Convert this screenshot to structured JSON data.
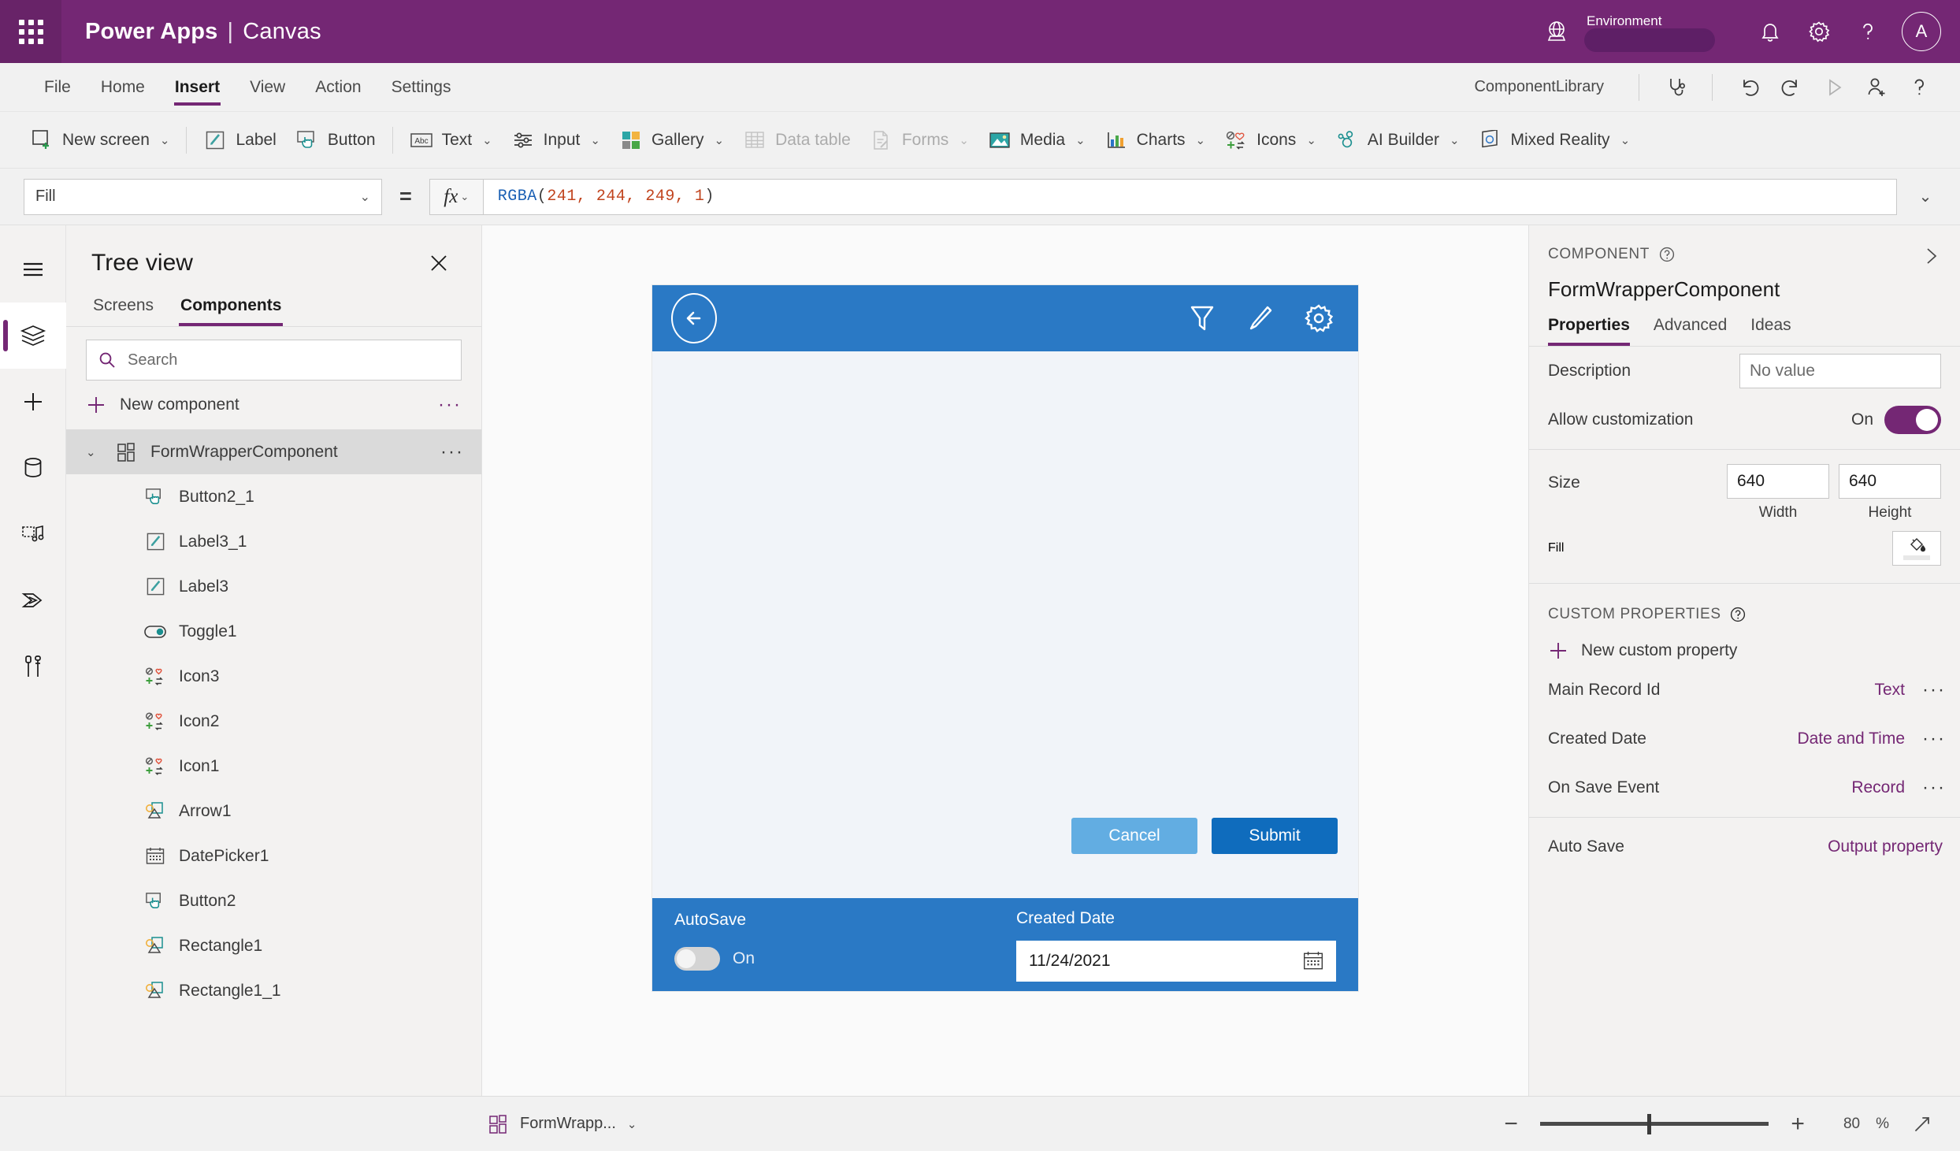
{
  "topbar": {
    "waffle": "app-launcher",
    "brand": "Power Apps",
    "separator": "|",
    "product": "Canvas",
    "environment_label": "Environment",
    "environment_value": "",
    "icons": [
      "globe-icon",
      "bell-icon",
      "gear-icon",
      "help-icon"
    ],
    "avatar_initial": "A"
  },
  "menubar": {
    "items": [
      {
        "label": "File",
        "active": false
      },
      {
        "label": "Home",
        "active": false
      },
      {
        "label": "Insert",
        "active": true
      },
      {
        "label": "View",
        "active": false
      },
      {
        "label": "Action",
        "active": false
      },
      {
        "label": "Settings",
        "active": false
      }
    ],
    "app_name": "ComponentLibrary",
    "right_icons": [
      "stethoscope-icon",
      "undo-icon",
      "redo-icon",
      "play-icon",
      "share-icon",
      "help-icon"
    ]
  },
  "ribbon": {
    "items": [
      {
        "label": "New screen",
        "icon": "new-screen-icon",
        "caret": true,
        "disabled": false
      },
      {
        "label": "Label",
        "icon": "label-icon",
        "caret": false,
        "disabled": false
      },
      {
        "label": "Button",
        "icon": "button-icon",
        "caret": false,
        "disabled": false
      },
      {
        "label": "Text",
        "icon": "text-icon",
        "caret": true,
        "disabled": false
      },
      {
        "label": "Input",
        "icon": "input-icon",
        "caret": true,
        "disabled": false
      },
      {
        "label": "Gallery",
        "icon": "gallery-icon",
        "caret": true,
        "disabled": false
      },
      {
        "label": "Data table",
        "icon": "data-table-icon",
        "caret": false,
        "disabled": true
      },
      {
        "label": "Forms",
        "icon": "forms-icon",
        "caret": true,
        "disabled": true
      },
      {
        "label": "Media",
        "icon": "media-icon",
        "caret": true,
        "disabled": false
      },
      {
        "label": "Charts",
        "icon": "charts-icon",
        "caret": true,
        "disabled": false
      },
      {
        "label": "Icons",
        "icon": "icons-icon",
        "caret": true,
        "disabled": false
      },
      {
        "label": "AI Builder",
        "icon": "ai-builder-icon",
        "caret": true,
        "disabled": false
      },
      {
        "label": "Mixed Reality",
        "icon": "mixed-reality-icon",
        "caret": true,
        "disabled": false
      }
    ]
  },
  "formula_bar": {
    "property": "Fill",
    "equals": "=",
    "fx": "fx",
    "formula_fn": "RGBA",
    "formula_open": "(",
    "formula_args": "241, 244, 249, 1",
    "formula_close": ")"
  },
  "rail": {
    "items": [
      {
        "name": "hamburger-icon",
        "selected": false
      },
      {
        "name": "tree-view-icon",
        "selected": true
      },
      {
        "name": "insert-icon",
        "selected": false
      },
      {
        "name": "data-icon",
        "selected": false
      },
      {
        "name": "media-icon",
        "selected": false
      },
      {
        "name": "power-automate-icon",
        "selected": false
      },
      {
        "name": "variables-icon",
        "selected": false
      }
    ]
  },
  "tree": {
    "title": "Tree view",
    "close": "×",
    "tabs": [
      {
        "label": "Screens",
        "active": false
      },
      {
        "label": "Components",
        "active": true
      }
    ],
    "search_placeholder": "Search",
    "new_component": "New component",
    "root": {
      "label": "FormWrapperComponent",
      "icon": "component-icon",
      "selected": true,
      "expanded": true
    },
    "children": [
      {
        "label": "Button2_1",
        "icon": "button-icon"
      },
      {
        "label": "Label3_1",
        "icon": "label-icon"
      },
      {
        "label": "Label3",
        "icon": "label-icon"
      },
      {
        "label": "Toggle1",
        "icon": "toggle-icon"
      },
      {
        "label": "Icon3",
        "icon": "icons-icon"
      },
      {
        "label": "Icon2",
        "icon": "icons-icon"
      },
      {
        "label": "Icon1",
        "icon": "icons-icon"
      },
      {
        "label": "Arrow1",
        "icon": "shape-icon"
      },
      {
        "label": "DatePicker1",
        "icon": "datepicker-icon"
      },
      {
        "label": "Button2",
        "icon": "button-icon"
      },
      {
        "label": "Rectangle1",
        "icon": "shape-icon"
      },
      {
        "label": "Rectangle1_1",
        "icon": "shape-icon"
      }
    ]
  },
  "canvas": {
    "header_icons": [
      "back-arrow-icon",
      "filter-icon",
      "pencil-icon",
      "gear-icon"
    ],
    "cancel_label": "Cancel",
    "submit_label": "Submit",
    "autosave_label": "AutoSave",
    "autosave_state": "On",
    "created_date_label": "Created Date",
    "created_date_value": "11/24/2021",
    "calendar_icon": "calendar-icon",
    "colors": {
      "header": "#2a79c5",
      "body": "#f1f4f9",
      "submit": "#0f6cbd",
      "cancel": "#62ade2"
    }
  },
  "properties": {
    "kicker": "COMPONENT",
    "help_icon": "help-circle-icon",
    "expand_icon": "chevron-right-icon",
    "component_name": "FormWrapperComponent",
    "tabs": [
      {
        "label": "Properties",
        "active": true
      },
      {
        "label": "Advanced",
        "active": false
      },
      {
        "label": "Ideas",
        "active": false
      }
    ],
    "description_label": "Description",
    "description_value": "No value",
    "allow_customization_label": "Allow customization",
    "allow_customization_state": "On",
    "size_label": "Size",
    "width_value": "640",
    "width_caption": "Width",
    "height_value": "640",
    "height_caption": "Height",
    "fill_label": "Fill",
    "fill_icon": "paint-bucket-icon",
    "custom_properties_kicker": "CUSTOM PROPERTIES",
    "new_custom_property": "New custom property",
    "custom_properties": [
      {
        "name": "Main Record Id",
        "type": "Text",
        "has_menu": true
      },
      {
        "name": "Created Date",
        "type": "Date and Time",
        "has_menu": true
      },
      {
        "name": "On Save Event",
        "type": "Record",
        "has_menu": true
      },
      {
        "name": "Auto Save",
        "type": "Output property",
        "has_menu": false
      }
    ],
    "accent": "#742774"
  },
  "statusbar": {
    "component_icon": "component-icon",
    "component_label": "FormWrapp...",
    "caret": "⌄",
    "zoom_out": "−",
    "zoom_in": "+",
    "zoom_value": "80",
    "zoom_unit": "%",
    "fullscreen_icon": "expand-icon"
  }
}
